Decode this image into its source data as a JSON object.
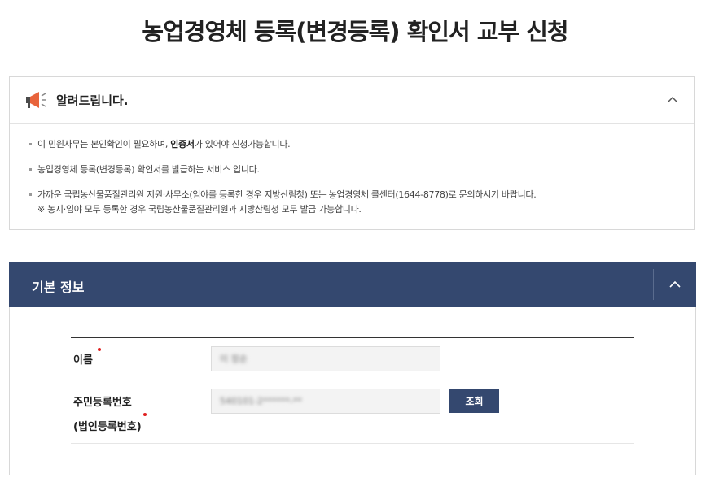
{
  "page": {
    "title": "농업경영체 등록(변경등록) 확인서 교부 신청"
  },
  "notice": {
    "title": "알려드립니다.",
    "item1_prefix": "이 민원사무는 본인확인이 필요하며, ",
    "item1_bold": "인증서",
    "item1_suffix": "가 있어야 신청가능합니다.",
    "item2": "농업경영체 등록(변경등록) 확인서를 발급하는 서비스 입니다.",
    "item3_line1": "가까운 국립농산물품질관리원 지원·사무소(임야를 등록한 경우 지방산림청) 또는 농업경영체 콜센터(1644-8778)로 문의하시기 바랍니다.",
    "item3_line2": "※ 농지·임야 모두 등록한 경우 국립농산물품질관리원과 지방산림청 모두 발급 가능합니다.",
    "toggle_icon": "chevron-up-icon",
    "megaphone_color": "#e8643c"
  },
  "basic_info": {
    "title": "기본 정보",
    "header_color": "#34486f",
    "fields": {
      "name_label": "이름",
      "name_value": "이 정순",
      "ssn_label_line1": "주민등록번호",
      "ssn_label_line2": "(법인등록번호)",
      "ssn_value": "540101-2******-**",
      "search_label": "조회"
    }
  }
}
